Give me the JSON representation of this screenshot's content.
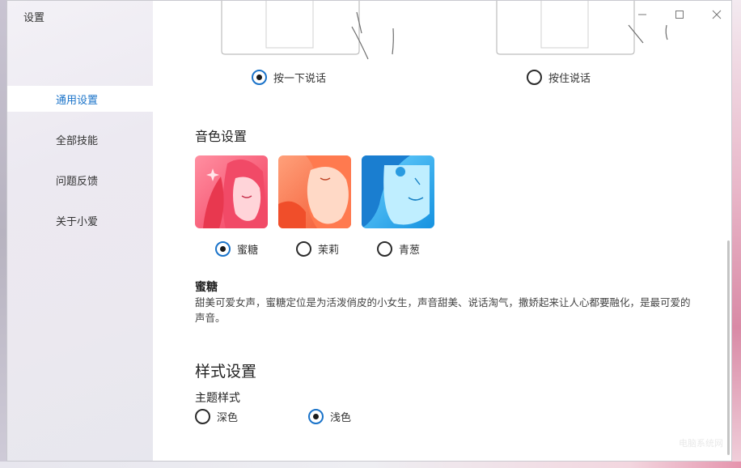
{
  "window": {
    "title": "设置",
    "controls": [
      "minimize",
      "maximize",
      "close"
    ]
  },
  "sidebar": {
    "items": [
      {
        "label": "通用设置",
        "active": true
      },
      {
        "label": "全部技能",
        "active": false
      },
      {
        "label": "问题反馈",
        "active": false
      },
      {
        "label": "关于小爱",
        "active": false
      }
    ]
  },
  "wake_mode": {
    "options": [
      {
        "label": "按一下说话",
        "checked": true
      },
      {
        "label": "按住说话",
        "checked": false
      }
    ]
  },
  "voice": {
    "title": "音色设置",
    "options": [
      {
        "label": "蜜糖",
        "checked": true,
        "color": "#f25a72"
      },
      {
        "label": "茉莉",
        "checked": false,
        "color": "#f7693f"
      },
      {
        "label": "青葱",
        "checked": false,
        "color": "#2aa9e8"
      }
    ],
    "selected_name": "蜜糖",
    "selected_desc": "甜美可爱女声，蜜糖定位是为活泼俏皮的小女生，声音甜美、说话淘气，撒娇起来让人心都要融化，是最可爱的声音。"
  },
  "style": {
    "title": "样式设置",
    "theme_label": "主题样式",
    "options": [
      {
        "label": "深色",
        "checked": false
      },
      {
        "label": "浅色",
        "checked": true
      }
    ]
  },
  "colors": {
    "accent": "#1a73c9",
    "sidebar_bg": "#ece9f1"
  },
  "watermark": "电脑系统网"
}
